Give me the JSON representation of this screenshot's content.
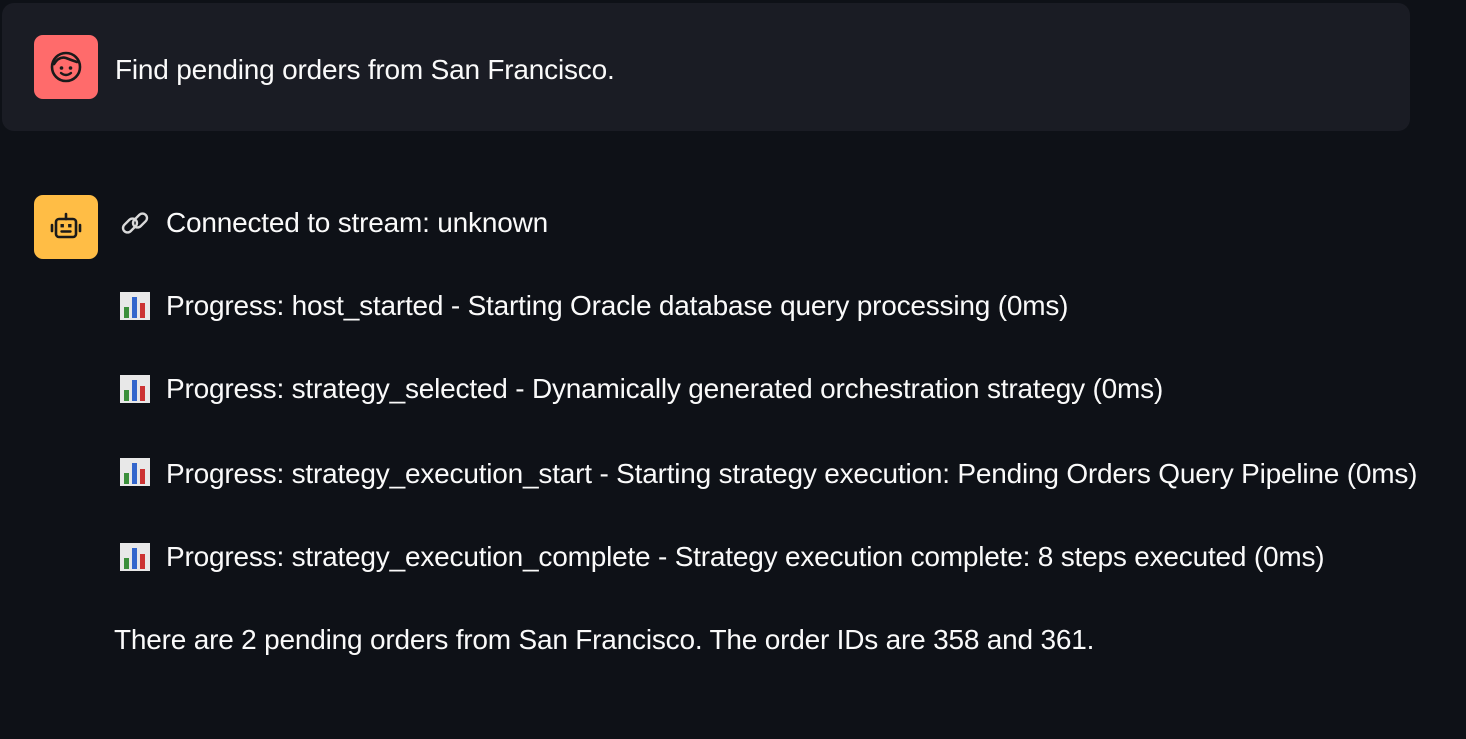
{
  "colors": {
    "background": "#0e1117",
    "user_bubble": "#1a1c24",
    "user_avatar": "#ff6b6b",
    "assistant_avatar": "#ffbd45",
    "text": "#fafafa"
  },
  "user_message": {
    "avatar_icon": "user-face-icon",
    "text": "Find pending orders from San Francisco."
  },
  "assistant_message": {
    "avatar_icon": "robot-icon",
    "connection": {
      "icon": "link-icon",
      "text": "Connected to stream: unknown"
    },
    "progress": [
      {
        "icon": "bar-chart-icon",
        "text": "Progress: host_started - Starting Oracle database query processing (0ms)"
      },
      {
        "icon": "bar-chart-icon",
        "text": "Progress: strategy_selected - Dynamically generated orchestration strategy (0ms)"
      },
      {
        "icon": "bar-chart-icon",
        "text": "Progress: strategy_execution_start - Starting strategy execution: Pending Orders Query Pipeline (0ms)"
      },
      {
        "icon": "bar-chart-icon",
        "text": "Progress: strategy_execution_complete - Strategy execution complete: 8 steps executed (0ms)"
      }
    ],
    "answer": "There are 2 pending orders from San Francisco. The order IDs are 358 and 361."
  }
}
